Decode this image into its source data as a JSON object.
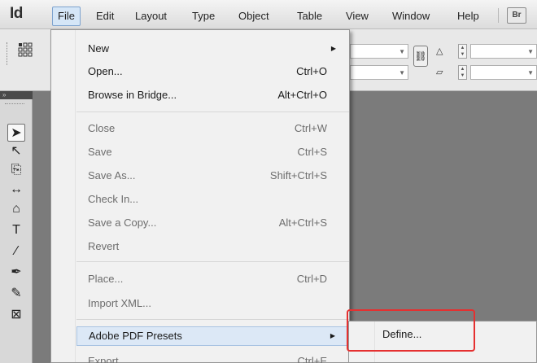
{
  "app": {
    "logo": "Id"
  },
  "menubar": {
    "items": [
      {
        "label": "File",
        "active": true
      },
      {
        "label": "Edit"
      },
      {
        "label": "Layout"
      },
      {
        "label": "Type"
      },
      {
        "label": "Object"
      },
      {
        "label": "Table"
      },
      {
        "label": "View"
      },
      {
        "label": "Window"
      },
      {
        "label": "Help"
      }
    ],
    "bridge_badge": "Br"
  },
  "file_menu": {
    "items": [
      {
        "label": "New",
        "shortcut": "",
        "submenu": true
      },
      {
        "label": "Open...",
        "shortcut": "Ctrl+O"
      },
      {
        "label": "Browse in Bridge...",
        "shortcut": "Alt+Ctrl+O"
      },
      {
        "label": "Close",
        "shortcut": "Ctrl+W",
        "disabled": true
      },
      {
        "label": "Save",
        "shortcut": "Ctrl+S",
        "disabled": true
      },
      {
        "label": "Save As...",
        "shortcut": "Shift+Ctrl+S",
        "disabled": true
      },
      {
        "label": "Check In...",
        "shortcut": "",
        "disabled": true
      },
      {
        "label": "Save a Copy...",
        "shortcut": "Alt+Ctrl+S",
        "disabled": true
      },
      {
        "label": "Revert",
        "shortcut": "",
        "disabled": true
      },
      {
        "label": "Place...",
        "shortcut": "Ctrl+D",
        "disabled": true
      },
      {
        "label": "Import XML...",
        "shortcut": "",
        "disabled": true
      },
      {
        "label": "Adobe PDF Presets",
        "shortcut": "",
        "submenu": true,
        "highlighted": true
      },
      {
        "label": "Export...",
        "shortcut": "Ctrl+E",
        "disabled": true
      }
    ]
  },
  "pdf_presets_submenu": {
    "items": [
      {
        "label": "Define..."
      }
    ]
  },
  "tools": {
    "items": [
      {
        "name": "selection-tool",
        "glyph": "➤"
      },
      {
        "name": "direct-selection-tool",
        "glyph": "↖"
      },
      {
        "name": "page-tool",
        "glyph": "⎘"
      },
      {
        "name": "gap-tool",
        "glyph": "↔"
      },
      {
        "name": "content-collector-tool",
        "glyph": "⌂"
      },
      {
        "name": "type-tool",
        "glyph": "T"
      },
      {
        "name": "line-tool",
        "glyph": "∕"
      },
      {
        "name": "pen-tool",
        "glyph": "✒"
      },
      {
        "name": "pencil-tool",
        "glyph": "✎"
      },
      {
        "name": "rectangle-frame-tool",
        "glyph": "⊠"
      }
    ]
  },
  "colors": {
    "menu_highlight": "#dce8f6",
    "annotation_red": "#e53030",
    "pasteboard": "#7b7b7b"
  }
}
